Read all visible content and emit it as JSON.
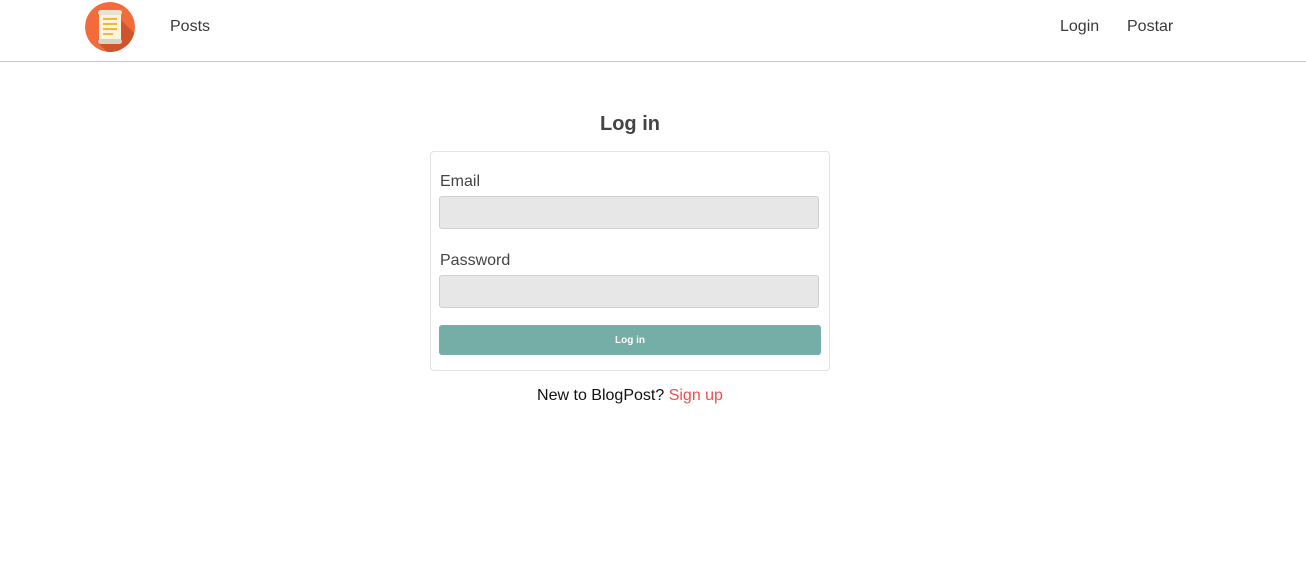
{
  "navbar": {
    "logo_name": "scroll-logo",
    "links": {
      "posts": "Posts",
      "login": "Login",
      "postar": "Postar"
    }
  },
  "main": {
    "title": "Log in",
    "form": {
      "email_label": "Email",
      "email_value": "",
      "password_label": "Password",
      "password_value": "",
      "submit_label": "Log in"
    },
    "signup": {
      "prompt": "New to BlogPost?",
      "link": "Sign up"
    }
  },
  "colors": {
    "logo_bg": "#f26b3a",
    "button_bg": "#74aea7",
    "signup_link": "#f04e4e",
    "input_bg": "#e7e7e7"
  }
}
